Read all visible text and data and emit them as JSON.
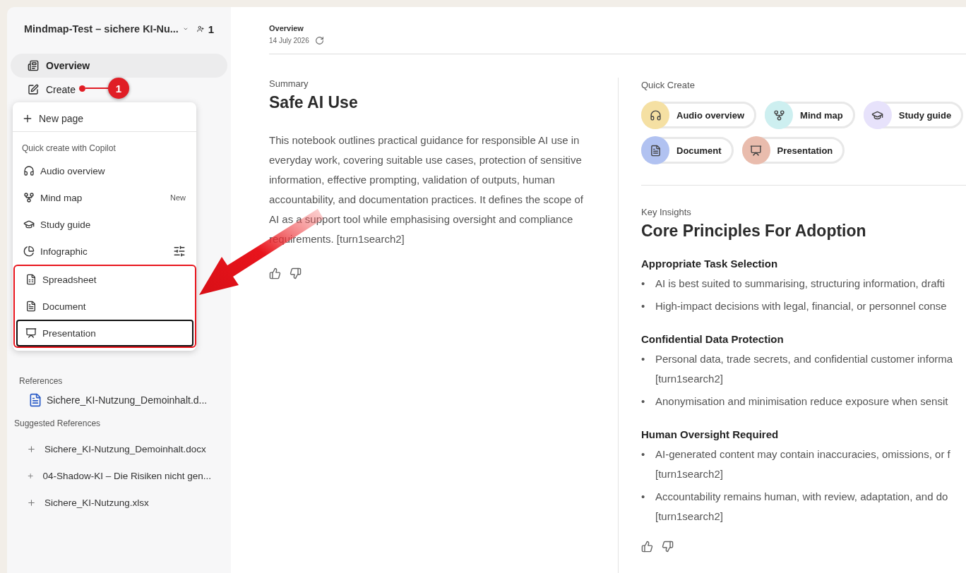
{
  "sidebar": {
    "notebook_title": "Mindmap-Test – sichere KI-Nu...",
    "members_count": "1",
    "nav": [
      {
        "label": "Overview",
        "selected": true
      },
      {
        "label": "Create",
        "selected": false
      }
    ],
    "references_label": "References",
    "references": [
      {
        "name": "Sichere_KI-Nutzung_Demoinhalt.d..."
      }
    ],
    "suggested_label": "Suggested References",
    "suggested": [
      {
        "name": "Sichere_KI-Nutzung_Demoinhalt.docx"
      },
      {
        "name": "04-Shadow-KI – Die Risiken nicht gen..."
      },
      {
        "name": "Sichere_KI-Nutzung.xlsx"
      }
    ]
  },
  "create_menu": {
    "new_page": "New page",
    "section_label": "Quick create with Copilot",
    "items": [
      {
        "label": "Audio overview",
        "focused": false
      },
      {
        "label": "Mind map",
        "badge": "New",
        "focused": false
      },
      {
        "label": "Study guide",
        "focused": false
      },
      {
        "label": "Infographic",
        "options": true,
        "focused": false
      },
      {
        "label": "Spreadsheet",
        "focused": false,
        "highlighted": true
      },
      {
        "label": "Document",
        "focused": false,
        "highlighted": true
      },
      {
        "label": "Presentation",
        "focused": true,
        "highlighted": true
      }
    ]
  },
  "annotation": {
    "step": "1"
  },
  "header": {
    "title": "Overview",
    "date": "14 July 2026"
  },
  "summary": {
    "label": "Summary",
    "title": "Safe AI Use",
    "text": "This notebook outlines practical guidance for responsible AI use in everyday work, covering suitable use cases, protection of sensitive information, effective prompting, validation of outputs, human accountability, and documentation practices. It defines the scope of AI as a support tool while emphasising oversight and compliance requirements. [turn1search2]"
  },
  "quick_create": {
    "label": "Quick Create",
    "items": [
      {
        "label": "Audio overview",
        "color": "#f5e0a3"
      },
      {
        "label": "Mind map",
        "color": "#cdeff0"
      },
      {
        "label": "Study guide",
        "color": "#e7e2fb"
      },
      {
        "label": "Document",
        "color": "#b1c2f1"
      },
      {
        "label": "Presentation",
        "color": "#e9bcad"
      }
    ]
  },
  "insights": {
    "label": "Key Insights",
    "title": "Core Principles For Adoption",
    "sections": [
      {
        "heading": "Appropriate Task Selection",
        "bullets": [
          {
            "marker": "•",
            "lines": [
              "AI is best suited to summarising, structuring information, drafti"
            ]
          },
          {
            "marker": "•",
            "lines": [
              "High-impact decisions with legal, financial, or personnel conse"
            ]
          }
        ]
      },
      {
        "heading": "Confidential Data Protection",
        "bullets": [
          {
            "marker": "•",
            "lines": [
              "Personal data, trade secrets, and confidential customer informa",
              "[turn1search2]"
            ]
          },
          {
            "marker": "•",
            "lines": [
              "Anonymisation and minimisation reduce exposure when sensit"
            ]
          }
        ]
      },
      {
        "heading": "Human Oversight Required",
        "bullets": [
          {
            "marker": "•",
            "lines": [
              "AI-generated content may contain inaccuracies, omissions, or f",
              "[turn1search2]"
            ]
          },
          {
            "marker": "•",
            "lines": [
              "Accountability remains human, with review, adaptation, and do",
              "[turn1search2]"
            ]
          }
        ]
      }
    ]
  }
}
